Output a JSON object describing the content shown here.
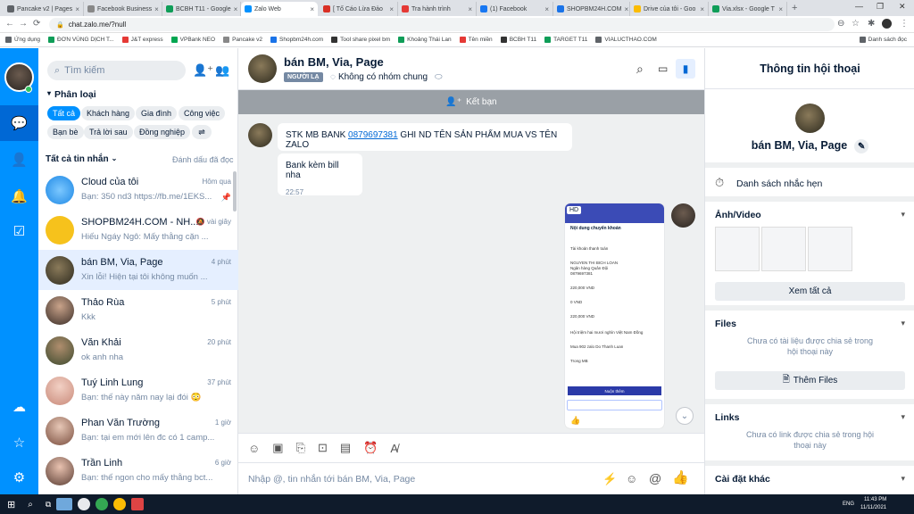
{
  "browser": {
    "tabs": [
      {
        "title": "Pancake v2 | Pages"
      },
      {
        "title": "Facebook Business"
      },
      {
        "title": "BCBH T11 - Google"
      },
      {
        "title": "Zalo Web"
      },
      {
        "title": "[ Tố Cáo Lừa Đảo"
      },
      {
        "title": "Tra hành trình"
      },
      {
        "title": "(1) Facebook"
      },
      {
        "title": "SHOPBM24H.COM"
      },
      {
        "title": "Drive của tôi - Goo"
      },
      {
        "title": "Via.xlsx - Google T"
      }
    ],
    "url": "chat.zalo.me/?null",
    "bookmarks": [
      "Ứng dụng",
      "ĐƠN VÙNG DỊCH T...",
      "J&T express",
      "VPBank NEO",
      "Pancake v2",
      "Shopbm24h.com",
      "Tool share pixel bm",
      "Khoảng Thái Lan",
      "Tên miền",
      "BCBH T11",
      "TARGET T11",
      "VIALUCTHAO.COM"
    ],
    "other_bookmarks": "Danh sách đọc"
  },
  "contacts": {
    "search_placeholder": "Tìm kiếm",
    "category_title": "Phân loại",
    "chips": [
      "Tất cả",
      "Khách hàng",
      "Gia đình",
      "Công việc",
      "Bạn bè",
      "Trả lời sau",
      "Đồng nghiệp"
    ],
    "list_title": "Tất cả tin nhắn",
    "mark_read": "Đánh dấu đã đọc",
    "conversations": [
      {
        "name": "Cloud của tôi",
        "preview": "Bạn: 350 nd3 https://fb.me/1EKS...",
        "time": "Hôm qua"
      },
      {
        "name": "SHOPBM24H.COM - NH...",
        "preview": "Hiếu Ngáy Ngô: Mấy thằng cặn ...",
        "time": "vài giây"
      },
      {
        "name": "bán BM, Via, Page",
        "preview": "Xin lỗi! Hiện tại tôi không muốn ...",
        "time": "4 phút"
      },
      {
        "name": "Thảo Rùa",
        "preview": "Kkk",
        "time": "5 phút"
      },
      {
        "name": "Văn Khải",
        "preview": "ok anh nha",
        "time": "20 phút"
      },
      {
        "name": "Tuý Linh Lung",
        "preview": "Bạn: thế này năm nay lại đói 😳",
        "time": "37 phút"
      },
      {
        "name": "Phan Văn Trường",
        "preview": "Bạn: tại em mới lên đc có 1 camp...",
        "time": "1 giờ"
      },
      {
        "name": "Trần Linh",
        "preview": "Bạn: thế ngon cho mấy thằng bct...",
        "time": "6 giờ"
      }
    ]
  },
  "chat": {
    "name": "bán BM, Via, Page",
    "stranger_badge": "NGƯỜI LẠ",
    "group_status": "Không có nhóm chung",
    "add_friend": "Kết bạn",
    "messages": [
      {
        "prefix": "STK MB BANK ",
        "link": "0879697381",
        "suffix": " GHI ND TÊN SẢN PHẨM MUA VS TÊN ZALO"
      },
      {
        "text": "Bank kèm bill nha",
        "time": "22:57"
      }
    ],
    "receipt": {
      "badge": "HD",
      "header": "Nội dung chuyển khoản",
      "lines": [
        "Tài khoản thanh toán",
        "NGUYEN THI BICH LOAN",
        "Ngân hàng Quân Đội",
        "0879697381",
        "220,000 VND",
        "0 VND",
        "220,000 VND",
        "Hội triệm hai mươi nghìn Việt Nam Đồng",
        "Mua 902 zalo Do Thanh Luan",
        "Trong MB"
      ],
      "button": "Nuộn thêm"
    },
    "input_placeholder": "Nhập @, tin nhắn tới bán BM, Via, Page"
  },
  "info": {
    "title": "Thông tin hội thoại",
    "name": "bán BM, Via, Page",
    "reminders": "Danh sách nhắc hẹn",
    "media_title": "Ảnh/Video",
    "see_all": "Xem tất cả",
    "files_title": "Files",
    "files_empty": "Chưa có tài liệu được chia sẻ trong hội thoại này",
    "add_files": "Thêm Files",
    "links_title": "Links",
    "links_empty": "Chưa có link được chia sẻ trong hội thoại này",
    "settings": "Cài đặt khác"
  },
  "taskbar": {
    "lang": "ENG",
    "time": "11:43 PM",
    "date": "11/11/2021"
  },
  "colors": {
    "zalo_blue": "#0091ff",
    "nav_selected": "#0068d5",
    "selected_row": "#e5efff"
  }
}
